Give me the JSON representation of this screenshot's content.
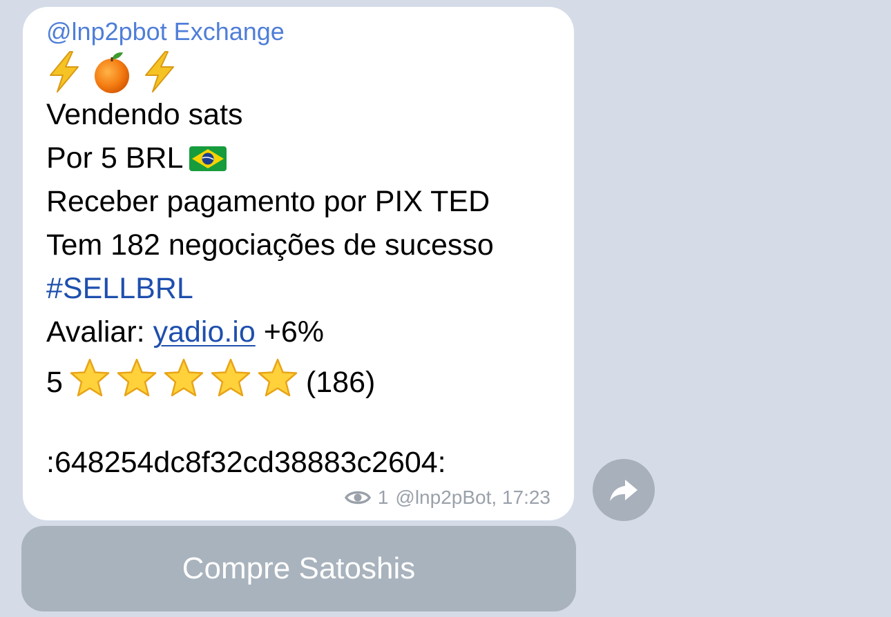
{
  "message": {
    "sender": "@lnp2pbot Exchange",
    "header_emojis": [
      "lightning-emoji",
      "orange-emoji",
      "lightning-emoji"
    ],
    "line1": "Vendendo sats",
    "line2": "Por 5 BRL",
    "line2_flag": "brazil-flag-emoji",
    "line3": "Receber pagamento por PIX TED",
    "line4": "Tem 182 negociações de sucesso",
    "hashtag": "#SELLBRL",
    "rate_prefix": "Avaliar: ",
    "rate_link": "yadio.io",
    "rate_suffix": " +6%",
    "rating_value": "5",
    "rating_stars": 5,
    "rating_count": "(186)",
    "order_id": ":648254dc8f32cd38883c2604:",
    "views": "1",
    "via_time": "@lnp2pBot, 17:23"
  },
  "inline_button": {
    "label": "Compre Satoshis"
  },
  "colors": {
    "background": "#d5dce8",
    "bubble": "#ffffff",
    "sender": "#4f7ed8",
    "link": "#1e4fae",
    "meta": "#9aa1aa",
    "button": "#a9b3bd"
  }
}
